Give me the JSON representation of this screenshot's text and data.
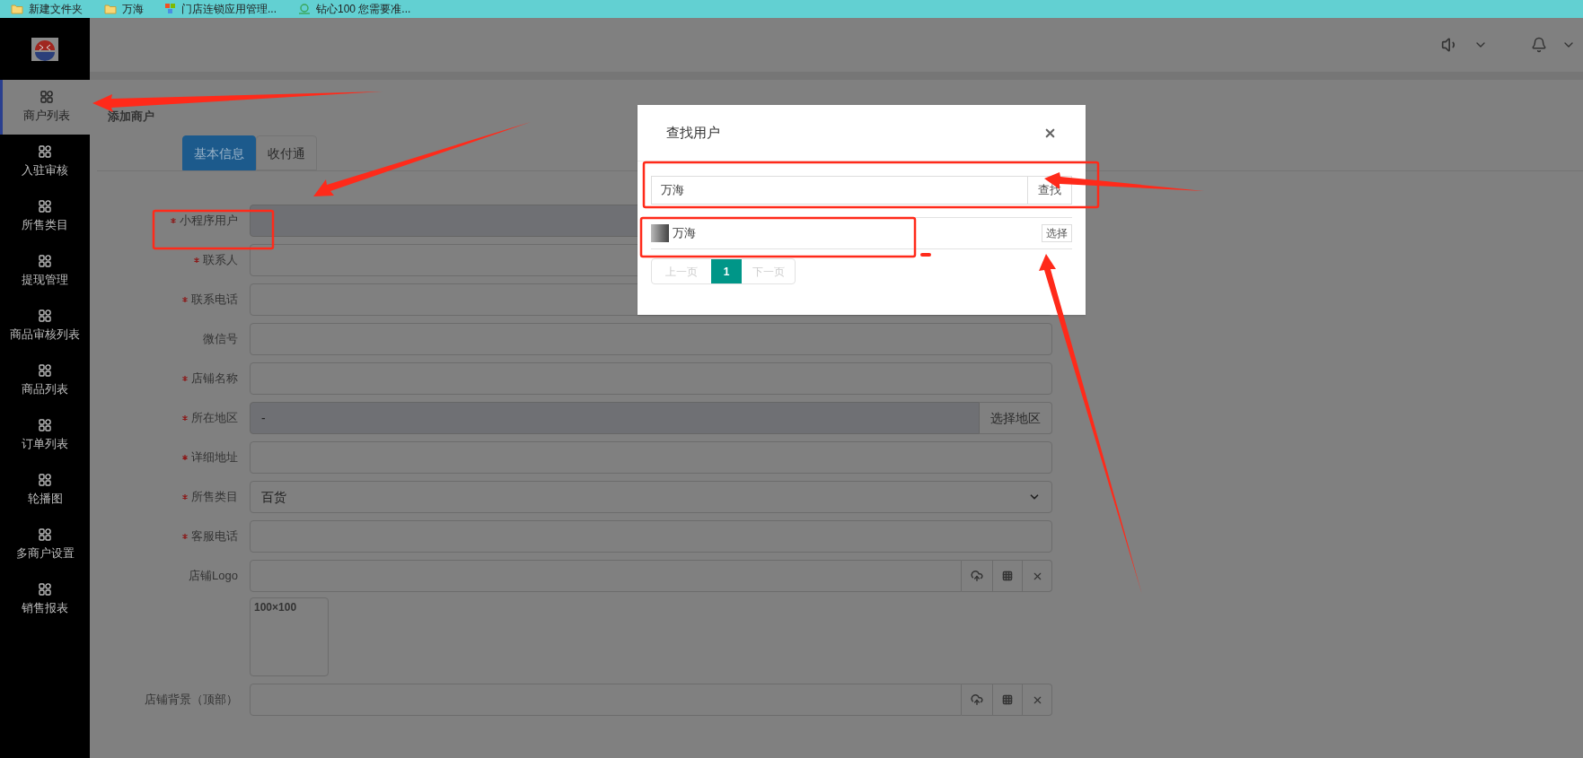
{
  "bookmarks": [
    {
      "label": "新建文件夹",
      "kind": "folder"
    },
    {
      "label": "万海",
      "kind": "folder"
    },
    {
      "label": "门店连锁应用管理...",
      "kind": "app"
    },
    {
      "label": "钻心100 您需要准...",
      "kind": "site"
    }
  ],
  "sidebar": {
    "items": [
      {
        "label": "商户列表",
        "selected": true
      },
      {
        "label": "入驻审核",
        "selected": false
      },
      {
        "label": "所售类目",
        "selected": false
      },
      {
        "label": "提现管理",
        "selected": false
      },
      {
        "label": "商品审核列表",
        "selected": false
      },
      {
        "label": "商品列表",
        "selected": false
      },
      {
        "label": "订单列表",
        "selected": false
      },
      {
        "label": "轮播图",
        "selected": false
      },
      {
        "label": "多商户设置",
        "selected": false
      },
      {
        "label": "销售报表",
        "selected": false
      }
    ]
  },
  "breadcrumb": "添加商户",
  "tabs": [
    {
      "label": "基本信息",
      "selected": true
    },
    {
      "label": "收付通",
      "selected": false
    }
  ],
  "form": {
    "fields": [
      {
        "label": "小程序用户",
        "required": true,
        "kind": "text",
        "disabled": true
      },
      {
        "label": "联系人",
        "required": true,
        "kind": "text",
        "disabled": false
      },
      {
        "label": "联系电话",
        "required": true,
        "kind": "text",
        "disabled": false
      },
      {
        "label": "微信号",
        "required": false,
        "kind": "text",
        "disabled": false
      },
      {
        "label": "店铺名称",
        "required": true,
        "kind": "text",
        "disabled": false
      },
      {
        "label": "所在地区",
        "required": true,
        "kind": "addon",
        "disabled": true,
        "value": "-",
        "button": "选择地区"
      },
      {
        "label": "详细地址",
        "required": true,
        "kind": "text",
        "disabled": false
      },
      {
        "label": "所售类目",
        "required": true,
        "kind": "select",
        "disabled": false,
        "value": "百货"
      },
      {
        "label": "客服电话",
        "required": true,
        "kind": "text",
        "disabled": false
      },
      {
        "label": "店铺Logo",
        "required": false,
        "kind": "image",
        "disabled": false,
        "preview": "100×100"
      },
      {
        "label": "店铺背景（顶部）",
        "required": false,
        "kind": "image",
        "disabled": false
      }
    ]
  },
  "modal": {
    "title": "查找用户",
    "search": {
      "value": "万海"
    },
    "search_button": "查找",
    "results": [
      {
        "name": "万海",
        "action": "选择"
      }
    ],
    "pagination": {
      "prev": {
        "label": "上一页",
        "disabled": true
      },
      "pages": [
        {
          "label": "1",
          "selected": true
        }
      ],
      "next": {
        "label": "下一页",
        "disabled": true
      }
    }
  }
}
